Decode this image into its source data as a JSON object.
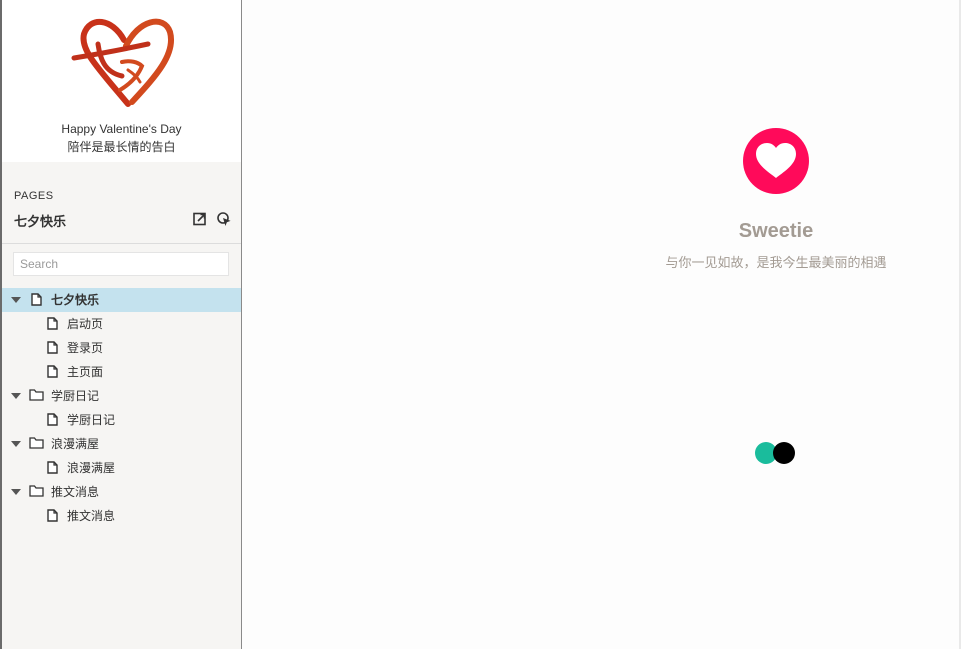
{
  "sidebar": {
    "brand": {
      "logo": "qixi-heart-logo",
      "line1": "Happy Valentine's Day",
      "line2": "陪伴是最长情的告白"
    },
    "pages_label": "PAGES",
    "project_title": "七夕快乐",
    "tools": [
      "export-icon",
      "pointer-icon"
    ],
    "search": {
      "placeholder": "Search",
      "value": ""
    },
    "tree": [
      {
        "label": "七夕快乐",
        "type": "page",
        "expanded": true,
        "selected": true
      },
      {
        "label": "启动页",
        "type": "page"
      },
      {
        "label": "登录页",
        "type": "page"
      },
      {
        "label": "主页面",
        "type": "page"
      },
      {
        "label": "学厨日记",
        "type": "folder",
        "expanded": true
      },
      {
        "label": "学厨日记",
        "type": "page"
      },
      {
        "label": "浪漫满屋",
        "type": "folder",
        "expanded": true
      },
      {
        "label": "浪漫满屋",
        "type": "page"
      },
      {
        "label": "推文消息",
        "type": "folder",
        "expanded": true
      },
      {
        "label": "推文消息",
        "type": "page"
      }
    ]
  },
  "main": {
    "app_name": "Sweetie",
    "tagline": "与你一见如故，是我今生最美丽的相遇",
    "icon": "heart-icon",
    "colors": {
      "heart_badge": "#ff0a5a",
      "loader_teal": "#1abc9c",
      "loader_black": "#000000",
      "selected_row": "#c4e2ee",
      "text_muted": "#a39b93"
    }
  }
}
